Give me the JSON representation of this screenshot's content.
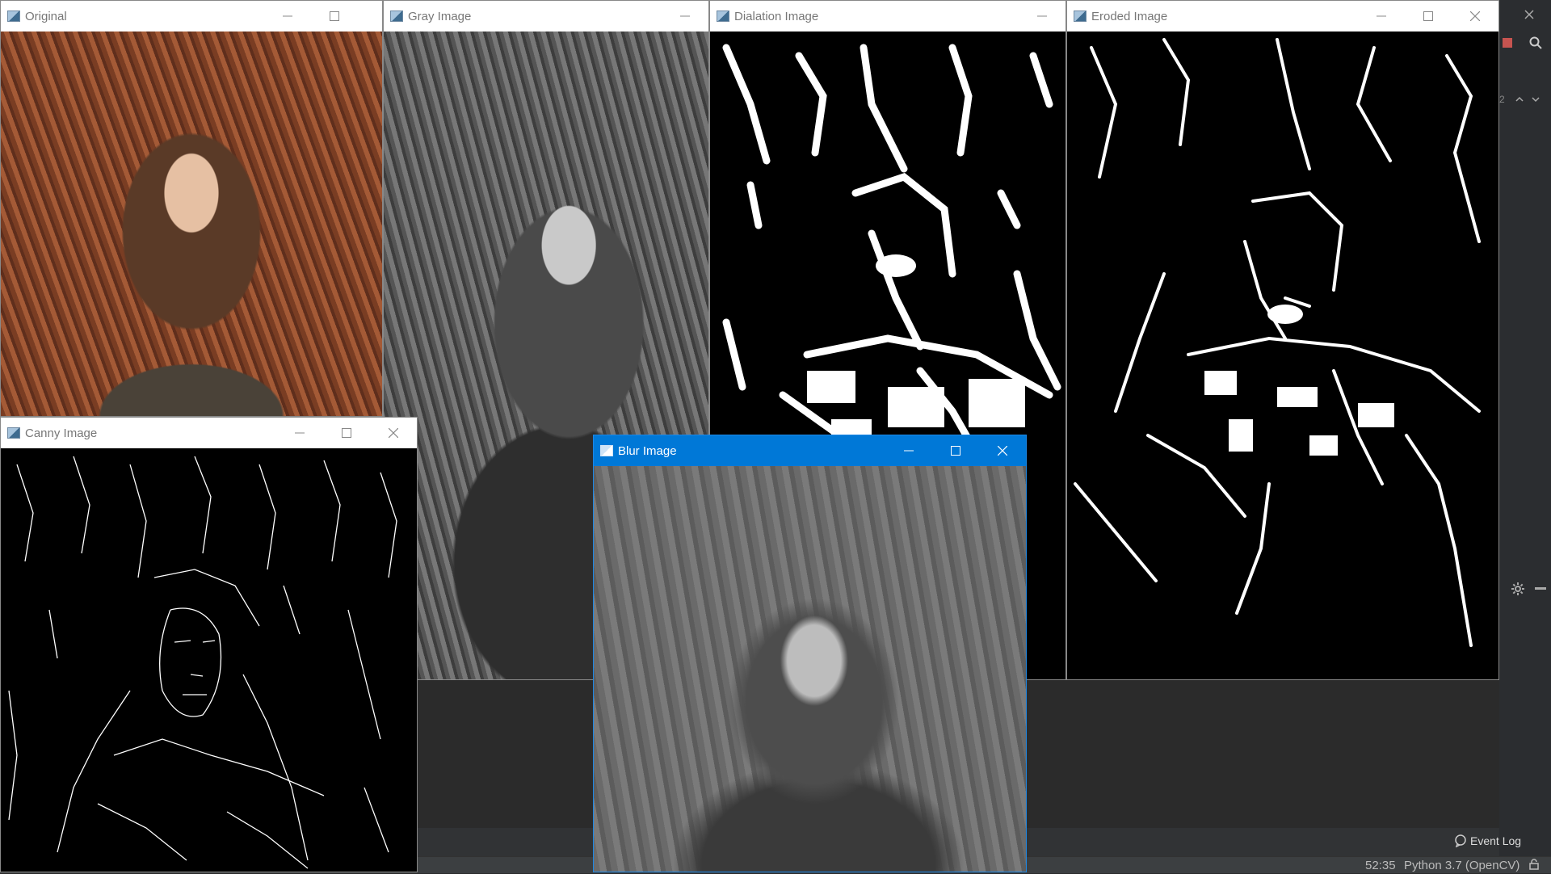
{
  "windows": {
    "original": {
      "title": "Original"
    },
    "gray": {
      "title": "Gray Image"
    },
    "dilation": {
      "title": "Dialation Image"
    },
    "eroded": {
      "title": "Eroded Image"
    },
    "canny": {
      "title": "Canny Image"
    },
    "blur": {
      "title": "Blur Image"
    }
  },
  "ide": {
    "event_log": "Event Log",
    "cursor_position": "52:35",
    "interpreter": "Python 3.7 (OpenCV)",
    "gutter_number": "2"
  },
  "colors": {
    "active_titlebar": "#0078d7",
    "ide_background": "#2b2b2b"
  }
}
